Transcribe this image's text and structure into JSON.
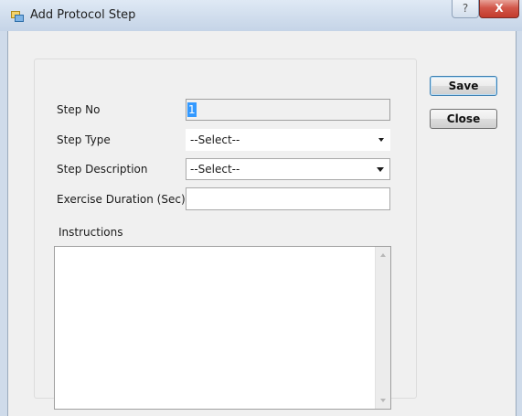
{
  "window": {
    "title": "Add Protocol Step",
    "help_glyph": "?",
    "close_glyph": "X"
  },
  "form": {
    "step_no": {
      "label": "Step No",
      "value": "1"
    },
    "step_type": {
      "label": "Step Type",
      "selected": "--Select--"
    },
    "step_description": {
      "label": "Step Description",
      "selected": "--Select--"
    },
    "exercise_duration": {
      "label": "Exercise Duration (Sec)",
      "value": ""
    },
    "instructions": {
      "label": "Instructions",
      "value": ""
    }
  },
  "buttons": {
    "save": "Save",
    "close": "Close"
  },
  "icons": {
    "title": "app-window-icon",
    "help": "question-icon",
    "close": "close-icon"
  }
}
